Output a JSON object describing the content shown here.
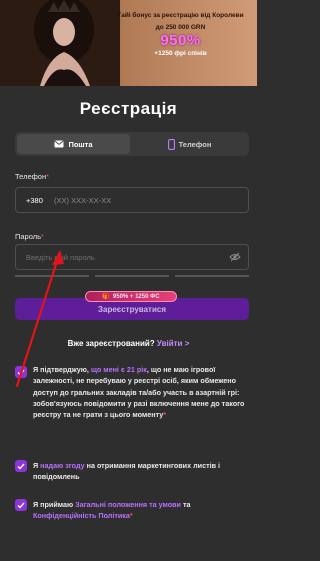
{
  "banner": {
    "line1": "Тайі бонус за реєстрацію від Королеви",
    "line2": "до 250 000 GRN",
    "line3": "950%",
    "line4": "+1250 фрі спінів"
  },
  "form": {
    "title": "Реєстрація",
    "tabs": [
      {
        "label": "Пошта",
        "icon": "mail-icon"
      },
      {
        "label": "Телефон",
        "icon": "phone-icon"
      }
    ],
    "phone_label": "Телефон",
    "phone_prefix": "+380",
    "phone_placeholder": "(XX) XXX-XX-XX",
    "password_label": "Пароль",
    "password_placeholder": "Введіть свій пароль",
    "badge": "950% + 1250 ФС",
    "submit_label": "Зареєструватися",
    "login_prompt": "Вже зареєстрований?",
    "login_link": "Увійти >",
    "required_mark": "*"
  },
  "consents": {
    "c1": {
      "a": "Я підтверджую, ",
      "b": "що мені є 21 рік",
      "c": ", що не маю ігрової залежності, не перебуваю у реєстрі осіб, яким обмежено доступ до гральних закладів та/або участь в азартній грі: зобов'язуюсь повідомити у разі включення мене до такого реєстру та не грати з цього моменту"
    },
    "c2": {
      "a": "Я ",
      "b": "надаю згоду",
      "c": " на отримання маркетингових листів і повідомлень"
    },
    "c3": {
      "a": "Я приймаю ",
      "b": "Загальні положення та умови",
      "c": " та ",
      "d": "Конфіденційність Політика"
    }
  },
  "colors": {
    "background": "#2e2e2e",
    "accent": "#8d34d9",
    "link": "#b971ff",
    "annotation_arrow": "#e3131b"
  }
}
